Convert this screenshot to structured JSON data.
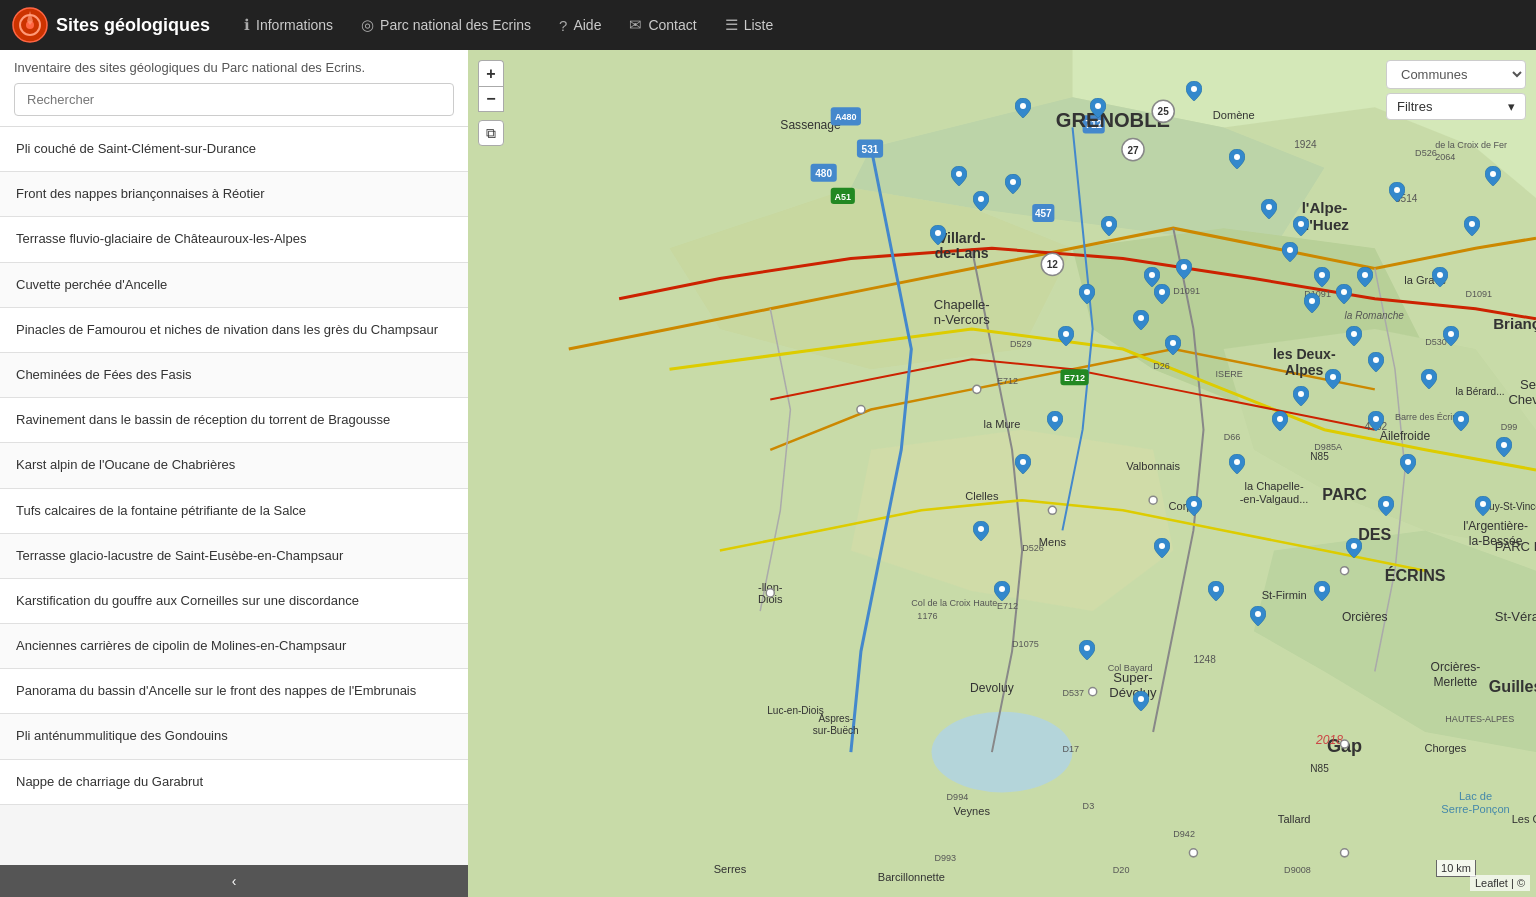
{
  "header": {
    "title": "Sites géologiques",
    "nav": [
      {
        "id": "informations",
        "label": "Informations",
        "icon": "ℹ"
      },
      {
        "id": "parc",
        "label": "Parc national des Ecrins",
        "icon": "◎"
      },
      {
        "id": "aide",
        "label": "Aide",
        "icon": "?"
      },
      {
        "id": "contact",
        "label": "Contact",
        "icon": "✉"
      },
      {
        "id": "liste",
        "label": "Liste",
        "icon": "☰"
      }
    ]
  },
  "sidebar": {
    "subtitle": "Inventaire des sites géologiques du Parc national des Ecrins.",
    "search_placeholder": "Rechercher",
    "collapse_icon": "‹",
    "sites": [
      "Pli couché de Saint-Clément-sur-Durance",
      "Front des nappes briançonnaises à Réotier",
      "Terrasse fluvio-glaciaire de Châteauroux-les-Alpes",
      "Cuvette perchée d'Ancelle",
      "Pinacles de Famourou et niches de nivation dans les grès du Champsaur",
      "Cheminées de Fées des Fasis",
      "Ravinement dans le bassin de réception du torrent de Bragousse",
      "Karst alpin de l'Oucane de Chabrières",
      "Tufs calcaires de la fontaine pétrifiante de la Salce",
      "Terrasse glacio-lacustre de Saint-Eusèbe-en-Champsaur",
      "Karstification du gouffre aux Corneilles sur une discordance",
      "Anciennes carrières de cipolin de Molines-en-Champsaur",
      "Panorama du bassin d'Ancelle sur le front des nappes de l'Embrunais",
      "Pli anténummulitique des Gondouins",
      "Nappe de charriage du Garabrut"
    ]
  },
  "map": {
    "zoom_in_label": "+",
    "zoom_out_label": "−",
    "layers_icon": "⧉",
    "communes_placeholder": "Communes",
    "filtres_label": "Filtres",
    "scale_text": "10 km",
    "attribution": "Leaflet | ©"
  },
  "markers": [
    {
      "x": 52,
      "y": 8
    },
    {
      "x": 59,
      "y": 8
    },
    {
      "x": 46,
      "y": 16
    },
    {
      "x": 48,
      "y": 19
    },
    {
      "x": 51,
      "y": 17
    },
    {
      "x": 44,
      "y": 23
    },
    {
      "x": 68,
      "y": 6
    },
    {
      "x": 72,
      "y": 14
    },
    {
      "x": 64,
      "y": 28
    },
    {
      "x": 65,
      "y": 30
    },
    {
      "x": 67,
      "y": 27
    },
    {
      "x": 63,
      "y": 33
    },
    {
      "x": 66,
      "y": 36
    },
    {
      "x": 60,
      "y": 22
    },
    {
      "x": 58,
      "y": 30
    },
    {
      "x": 56,
      "y": 35
    },
    {
      "x": 75,
      "y": 20
    },
    {
      "x": 78,
      "y": 22
    },
    {
      "x": 77,
      "y": 25
    },
    {
      "x": 80,
      "y": 28
    },
    {
      "x": 79,
      "y": 31
    },
    {
      "x": 82,
      "y": 30
    },
    {
      "x": 84,
      "y": 28
    },
    {
      "x": 83,
      "y": 35
    },
    {
      "x": 85,
      "y": 38
    },
    {
      "x": 81,
      "y": 40
    },
    {
      "x": 78,
      "y": 42
    },
    {
      "x": 76,
      "y": 45
    },
    {
      "x": 72,
      "y": 50
    },
    {
      "x": 68,
      "y": 55
    },
    {
      "x": 65,
      "y": 60
    },
    {
      "x": 70,
      "y": 65
    },
    {
      "x": 74,
      "y": 68
    },
    {
      "x": 80,
      "y": 65
    },
    {
      "x": 83,
      "y": 60
    },
    {
      "x": 86,
      "y": 55
    },
    {
      "x": 88,
      "y": 50
    },
    {
      "x": 85,
      "y": 45
    },
    {
      "x": 90,
      "y": 40
    },
    {
      "x": 92,
      "y": 35
    },
    {
      "x": 91,
      "y": 28
    },
    {
      "x": 94,
      "y": 22
    },
    {
      "x": 87,
      "y": 18
    },
    {
      "x": 96,
      "y": 16
    },
    {
      "x": 93,
      "y": 45
    },
    {
      "x": 95,
      "y": 55
    },
    {
      "x": 97,
      "y": 48
    },
    {
      "x": 55,
      "y": 45
    },
    {
      "x": 52,
      "y": 50
    },
    {
      "x": 48,
      "y": 58
    },
    {
      "x": 50,
      "y": 65
    },
    {
      "x": 58,
      "y": 72
    },
    {
      "x": 63,
      "y": 78
    }
  ]
}
